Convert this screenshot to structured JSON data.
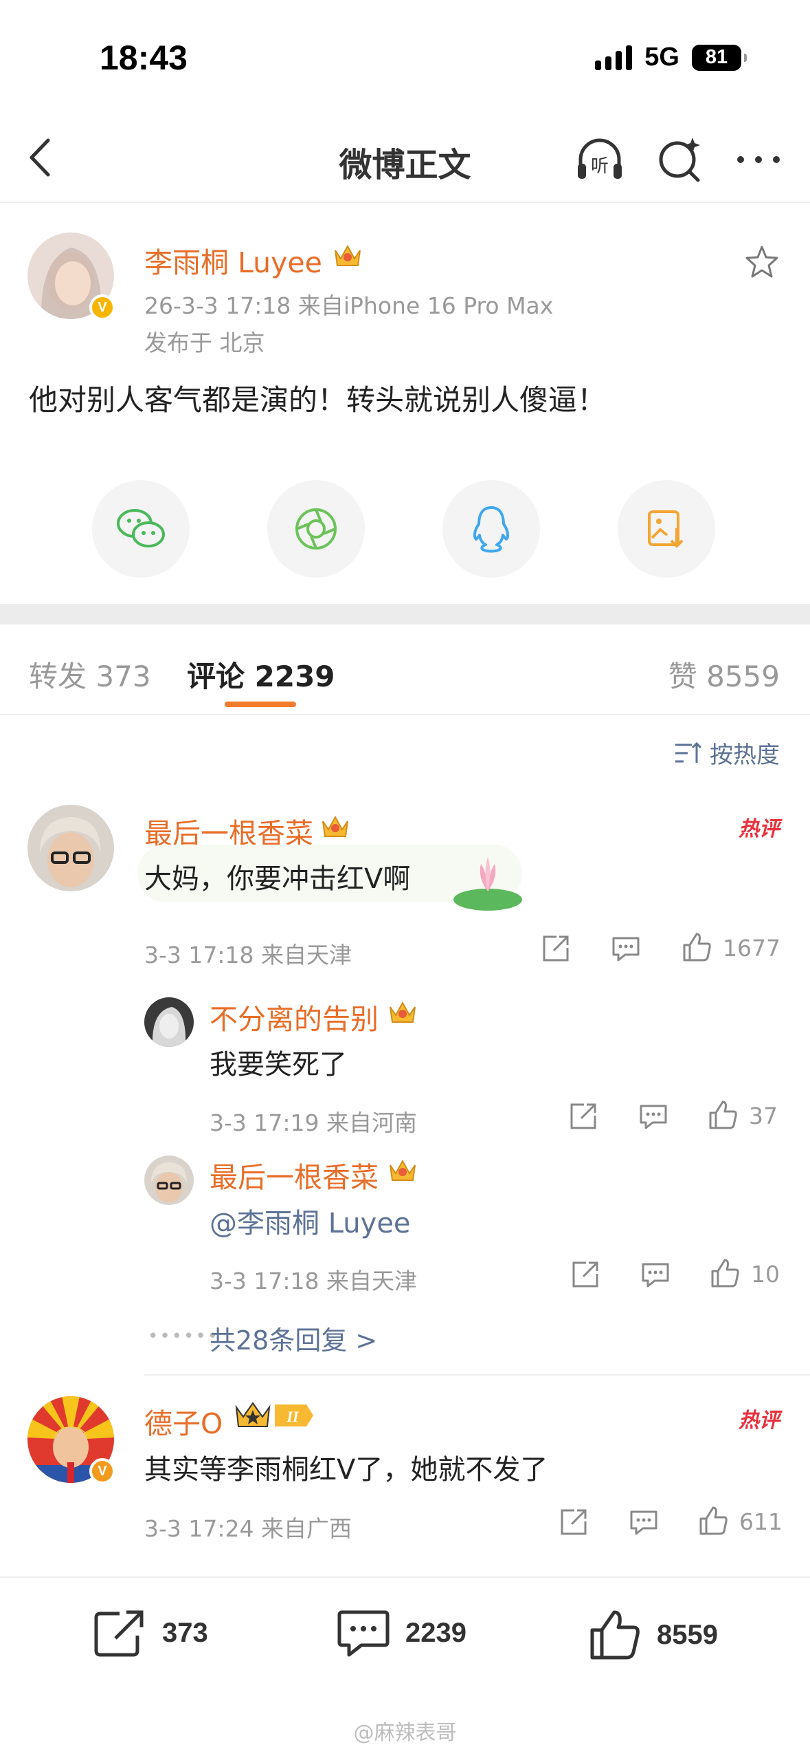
{
  "status": {
    "time": "18:43",
    "network": "5G",
    "battery": "81"
  },
  "nav": {
    "title": "微博正文"
  },
  "post": {
    "author": "李雨桐 Luyee",
    "time_source": "26-3-3 17:18  来自iPhone 16 Pro Max",
    "location": "发布于 北京",
    "text": "他对别人客气都是演的！转头就说别人傻逼！"
  },
  "tabs": {
    "repost_label": "转发",
    "repost_count": "373",
    "comment_label": "评论",
    "comment_count": "2239",
    "like_label": "赞",
    "like_count": "8559"
  },
  "sort_label": "按热度",
  "comments": [
    {
      "user": "最后一根香菜",
      "hot": "热评",
      "text": "大妈，你要冲击红Ⅴ啊",
      "meta": "3-3 17:18  来自天津",
      "likes": "1677",
      "replies": [
        {
          "user": "不分离的告别",
          "text": "我要笑死了",
          "meta": "3-3 17:19  来自河南",
          "likes": "37"
        },
        {
          "user": "最后一根香菜",
          "text": "@李雨桐 Luyee",
          "meta": "3-3 17:18  来自天津",
          "likes": "10"
        }
      ],
      "more_replies": "共28条回复 >"
    },
    {
      "user": "德子O",
      "hot": "热评",
      "text": "其实等李雨桐红Ⅴ了，她就不发了",
      "meta": "3-3 17:24  来自广西",
      "likes": "611"
    }
  ],
  "bottom_bar": {
    "repost": "373",
    "comment": "2239",
    "like": "8559"
  },
  "watermark": "@麻辣表哥",
  "colors": {
    "accent": "#f17c2c",
    "username": "#e86d28",
    "link": "#5d7296",
    "hot": "#e8313c"
  }
}
